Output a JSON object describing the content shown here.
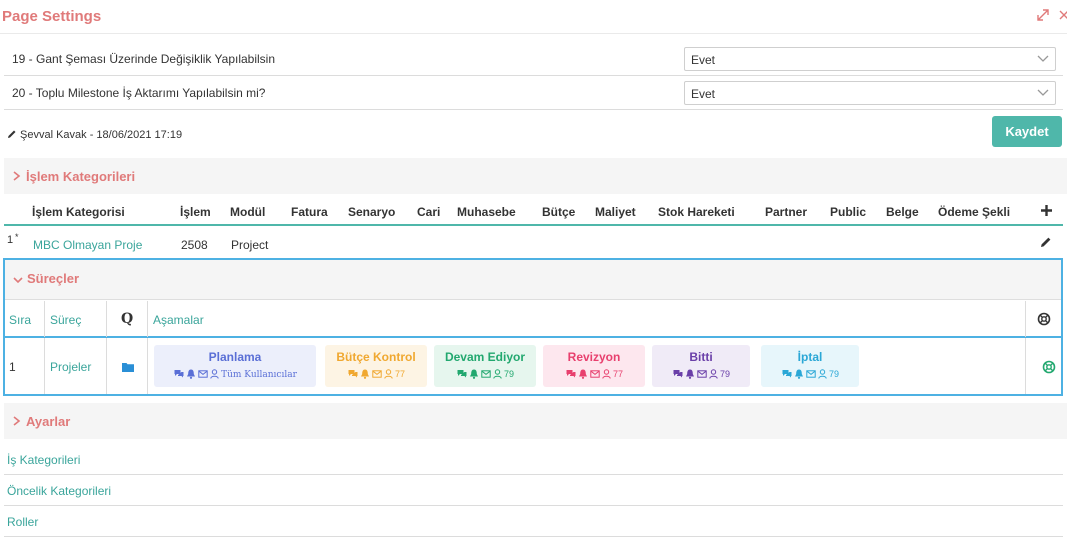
{
  "window": {
    "title": "Page Settings",
    "icons": [
      "expand-icon",
      "close-icon"
    ]
  },
  "settings": [
    {
      "label": "19 - Gant Şeması Üzerinde Değişiklik Yapılabilsin",
      "value": "Evet"
    },
    {
      "label": "20 - Toplu Milestone İş Aktarımı Yapılabilsin mi?",
      "value": "Evet"
    }
  ],
  "footer": {
    "author": "Şevval Kavak - 18/06/2021 17:19",
    "save_label": "Kaydet"
  },
  "islem_kategorileri": {
    "title": "İşlem Kategorileri",
    "columns": [
      "İşlem Kategorisi",
      "İşlem",
      "Modül",
      "Fatura",
      "Senaryo",
      "Cari",
      "Muhasebe",
      "Bütçe",
      "Maliyet",
      "Stok Hareketi",
      "Partner",
      "Public",
      "Belge",
      "Ödeme Şekli"
    ],
    "rows": [
      {
        "index": "1",
        "marker": "*",
        "category": "MBC Olmayan Proje",
        "islem": "2508",
        "modul": "Project"
      }
    ]
  },
  "surecler": {
    "title": "Süreçler",
    "columns": {
      "sira": "Sıra",
      "surec": "Süreç",
      "q": "Q",
      "asamalar": "Aşamalar"
    },
    "rows": [
      {
        "sira": "1",
        "surec": "Projeler",
        "stages": [
          {
            "name": "Planlama",
            "count": "Tüm Kullanıcılar",
            "color": "#5a6fd6",
            "bg": "#eceffb"
          },
          {
            "name": "Bütçe Kontrol",
            "count": "77",
            "color": "#f0a830",
            "bg": "#fdf4e4"
          },
          {
            "name": "Devam Ediyor",
            "count": "79",
            "color": "#22a86f",
            "bg": "#e6f6ee"
          },
          {
            "name": "Revizyon",
            "count": "77",
            "color": "#e8406e",
            "bg": "#fde7ee"
          },
          {
            "name": "Bitti",
            "count": "79",
            "color": "#6a3fa8",
            "bg": "#f0ebf7"
          },
          {
            "name": "İptal",
            "count": "79",
            "color": "#2aa7d6",
            "bg": "#e7f6fb"
          }
        ]
      }
    ]
  },
  "ayarlar": {
    "title": "Ayarlar",
    "links": [
      "İş Kategorileri",
      "Öncelik Kategorileri",
      "Roller"
    ]
  },
  "colors": {
    "accent_teal": "#4fb7aa",
    "section_title": "#e07a7a",
    "highlight_border": "#4db1e3"
  }
}
